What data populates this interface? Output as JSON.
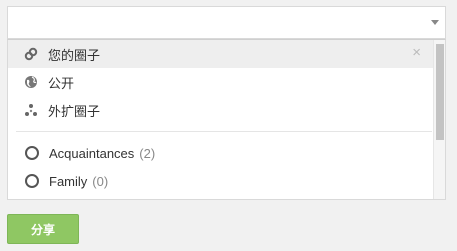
{
  "dropdown": {
    "items": [
      {
        "label": "您的圈子",
        "icon": "link-circles-icon"
      },
      {
        "label": "公开",
        "icon": "globe-icon"
      },
      {
        "label": "外扩圈子",
        "icon": "extended-circles-icon"
      }
    ],
    "circles": [
      {
        "label": "Acquaintances",
        "count": "(2)"
      },
      {
        "label": "Family",
        "count": "(0)"
      }
    ],
    "close_glyph": "×"
  },
  "share_button": {
    "label": "分享"
  },
  "colors": {
    "share_green": "#8fc763",
    "selected_row": "#eeeeee"
  }
}
